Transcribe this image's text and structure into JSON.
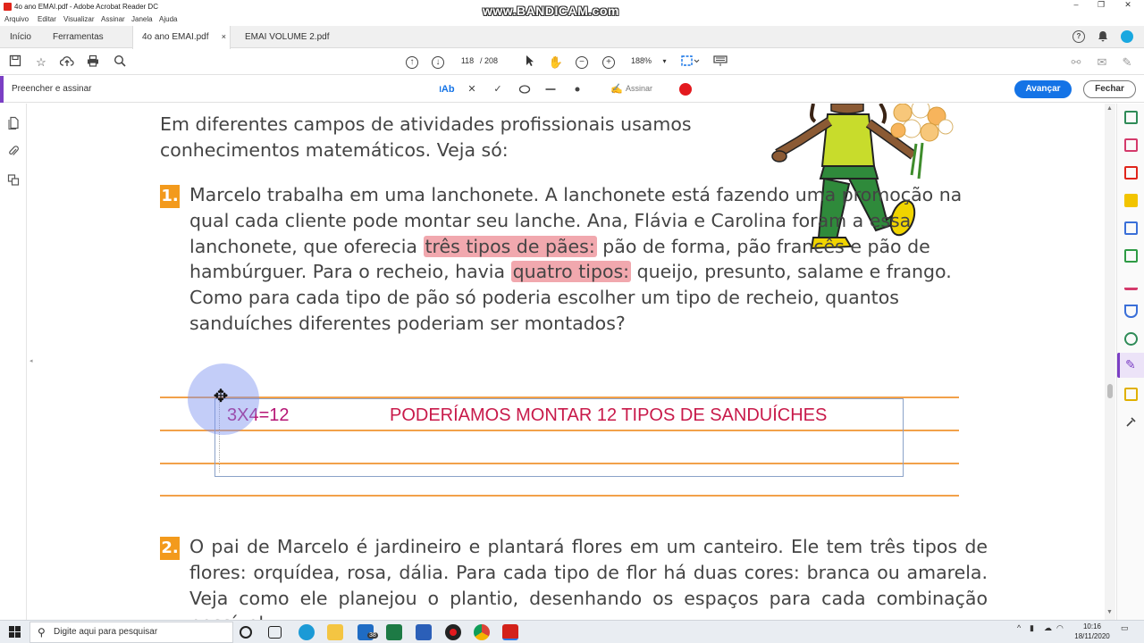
{
  "window": {
    "title": "4o ano EMAI.pdf - Adobe Acrobat Reader DC",
    "watermark": "www.BANDICAM.com",
    "controls": [
      "–",
      "❐",
      "✕"
    ]
  },
  "menu": [
    "Arquivo",
    "Editar",
    "Visualizar",
    "Assinar",
    "Janela",
    "Ajuda"
  ],
  "tabs": [
    {
      "label": "Início",
      "active": false
    },
    {
      "label": "Ferramentas",
      "active": false
    },
    {
      "label": "4o ano EMAI.pdf",
      "active": true,
      "close": "×"
    },
    {
      "label": "EMAI VOLUME 2.pdf",
      "active": false
    }
  ],
  "toolbar": {
    "page_current": "118",
    "page_total": "/ 208",
    "zoom": "188%",
    "zoom_caret": "▾"
  },
  "fill_sign": {
    "label": "Preencher e assinar",
    "text_tool": "Ab",
    "cross": "✕",
    "check": "✓",
    "sign_label": "Assinar",
    "next_button": "Avançar",
    "close_button": "Fechar",
    "record_color": "#e3191e"
  },
  "document": {
    "intro": "Em diferentes campos de atividades profissionais usamos conhecimentos matemáticos. Veja só:",
    "q1_number": "1.",
    "q1_part1": "Marcelo trabalha em uma lanchonete. A lanchonete está fazendo uma promoção na qual cada cliente pode montar seu lanche. Ana, Flávia e Carolina foram a essa lanchonete, que oferecia ",
    "q1_highlight1": "três tipos de pães:",
    "q1_part2": " pão de forma, pão francês e pão de hambúrguer. Para o recheio, havia ",
    "q1_highlight2": "quatro tipos:",
    "q1_part3": " queijo, presunto, salame e frango. Como para cada tipo de pão só poderia escolher um tipo de recheio, quantos sanduíches diferentes poderiam ser montados?",
    "answer_calc": "3X4=12",
    "answer_text": "PODERÍAMOS MONTAR 12 TIPOS DE SANDUÍCHES",
    "q2_number": "2.",
    "q2_text": "O pai de Marcelo é jardineiro e plantará flores em um canteiro. Ele tem três tipos de flores: orquídea, rosa, dália. Para cada tipo de flor há duas cores: branca ou amarela. Veja como ele planejou o plantio, desenhando os espaços para cada combinação possível:",
    "highlight_color": "#f1a8ae",
    "number_badge_color": "#f39a1c",
    "answer_line_color": "#f2a14a"
  },
  "taskbar": {
    "search_placeholder": "Digite aqui para pesquisar",
    "mail_badge": "38",
    "time": "10:16",
    "date": "18/11/2020"
  },
  "colors": {
    "accent_purple": "#7b3fc4",
    "primary_blue": "#1473e6"
  }
}
